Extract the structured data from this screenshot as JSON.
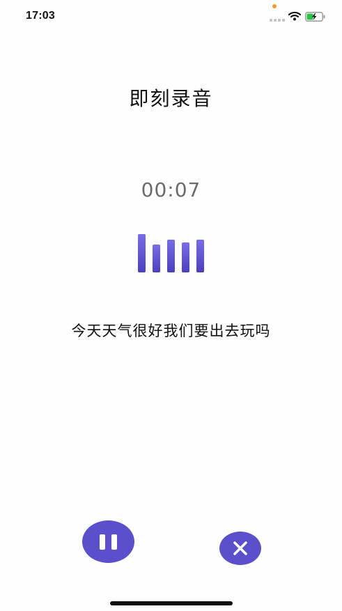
{
  "status_bar": {
    "time": "17:03",
    "signal_icon": "cellular-signal-icon",
    "wifi_icon": "wifi-icon",
    "battery_icon": "battery-charging-icon",
    "privacy_indicator_color": "#f29a2e"
  },
  "header": {
    "title": "即刻录音"
  },
  "recorder": {
    "elapsed": "00:07",
    "level_icon": "audio-level-bars-icon",
    "transcript": "今天天气很好我们要出去玩吗"
  },
  "controls": {
    "pause_icon": "pause-icon",
    "close_icon": "close-icon"
  },
  "colors": {
    "accent": "#5b4fcb",
    "timer_text": "#6b6b6b",
    "primary_text": "#111111"
  }
}
